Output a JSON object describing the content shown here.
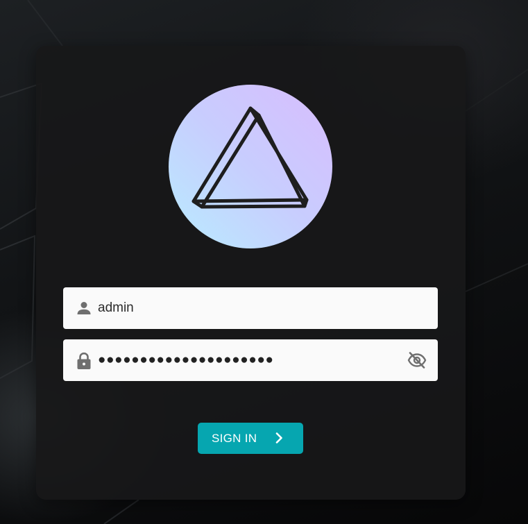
{
  "login": {
    "username_value": "admin",
    "password_masked": "●●●●●●●●●●●●●●●●●●●●●",
    "signin_label": "SIGN IN"
  },
  "icons": {
    "logo": "prism-triangle-logo",
    "username": "person-icon",
    "password": "lock-icon",
    "toggle_visibility": "eye-off-icon",
    "signin": "chevron-right-icon"
  },
  "colors": {
    "accent": "#06a6b0",
    "card": "#181819",
    "field": "#fafafa",
    "logo_gradient_start": "#b8ecff",
    "logo_gradient_end": "#d8bcfd"
  }
}
